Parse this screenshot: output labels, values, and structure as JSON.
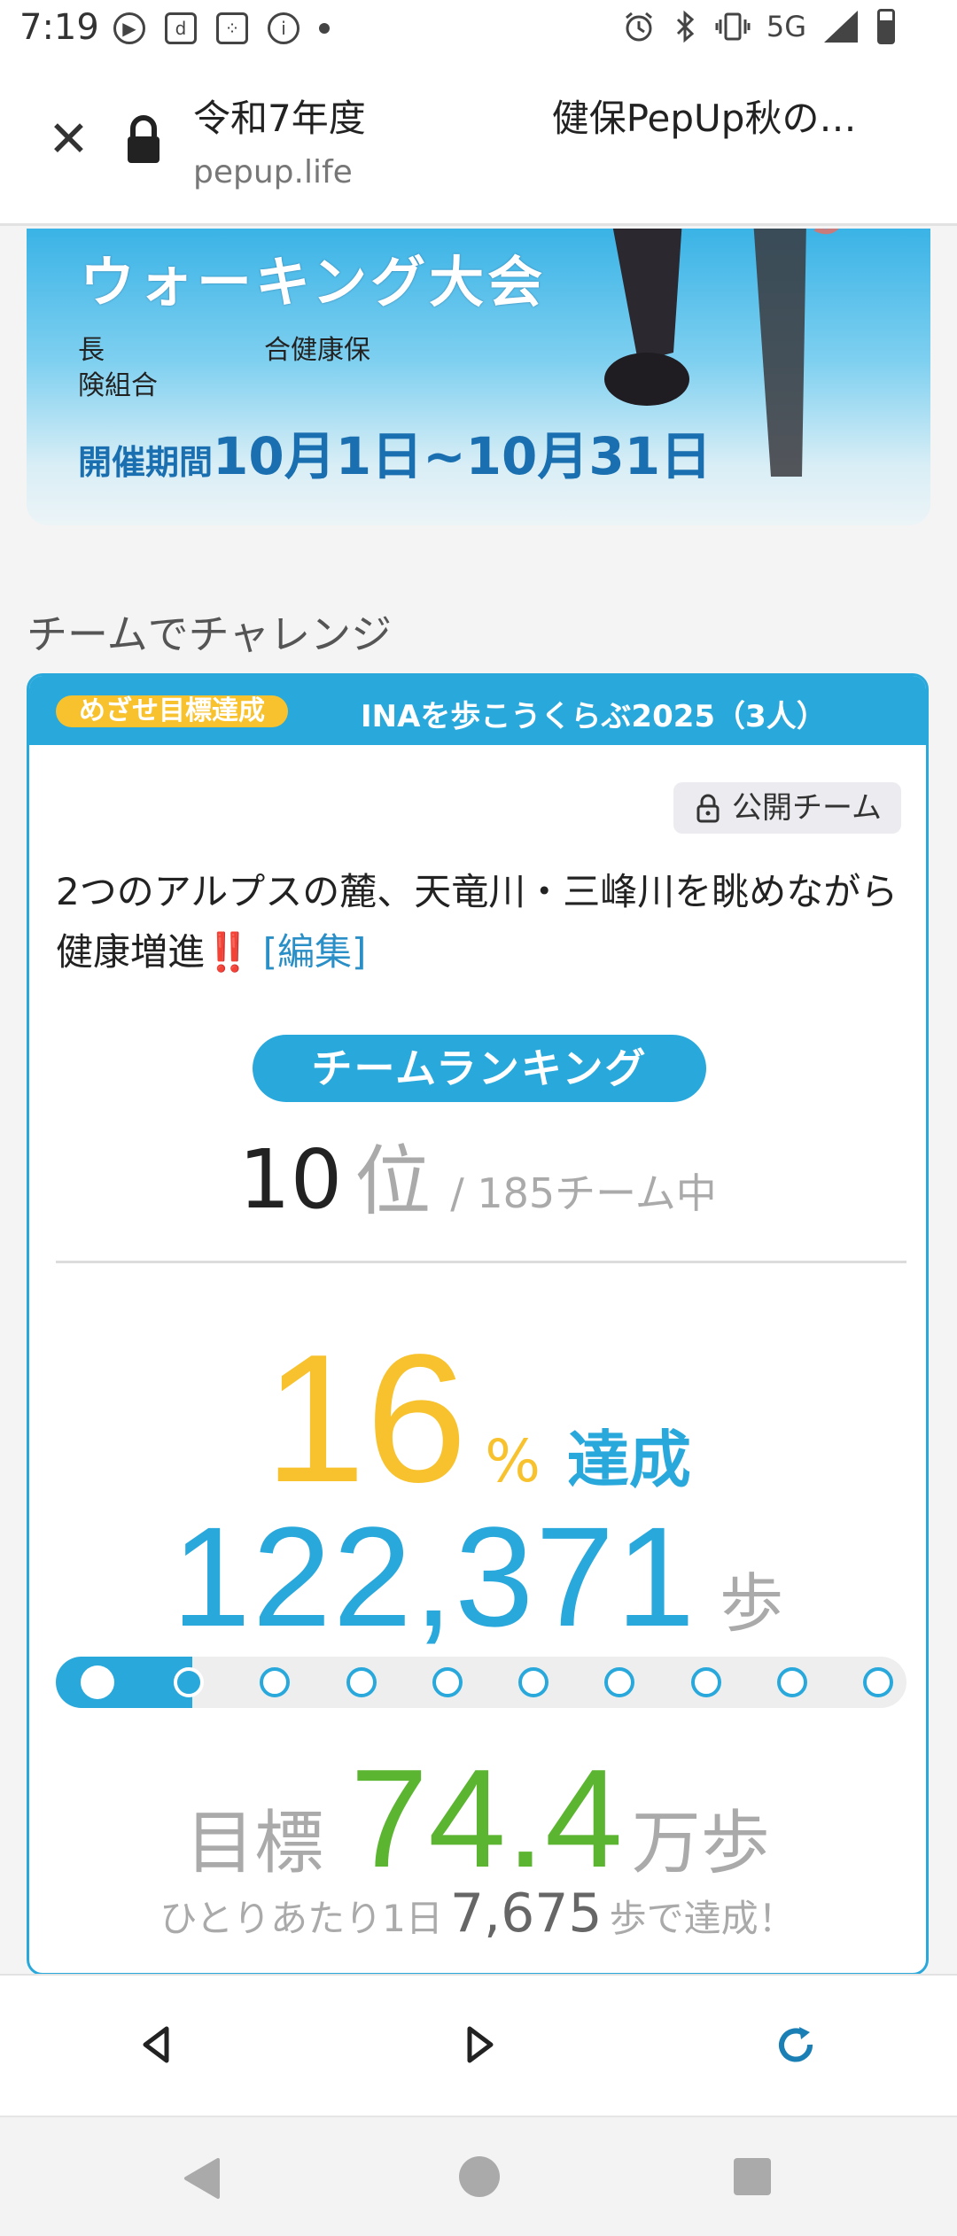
{
  "status_bar": {
    "time": "7:19",
    "network": "5G",
    "left_icons": [
      "play-icon",
      "d-icon",
      "dice-icon",
      "info-icon",
      "dot-icon"
    ],
    "right_icons": [
      "alarm-icon",
      "bluetooth-icon",
      "vibrate-icon",
      "signal-icon",
      "battery-icon"
    ]
  },
  "browser": {
    "page_title": "令和7年度　　　　　健保PepUp秋の…",
    "url": "pepup.life",
    "close_icon": "close-icon",
    "lock_icon": "lock-icon"
  },
  "banner": {
    "title": "ウォーキング大会",
    "org_line1": "長　　　　　　合健康保",
    "org_line2": "険組合",
    "period_label": "開催期間",
    "period_value": "10月1日~10月31日"
  },
  "section": {
    "heading": "チームでチャレンジ"
  },
  "team": {
    "goal_badge": "めざせ目標達成",
    "name": "INAを歩こうくらぶ2025（3人）",
    "public_badge": "公開チーム",
    "description": "2つのアルプスの麓、天竜川・三峰川を眺めながら健康増進",
    "exclamation": "‼️",
    "edit_link": "[編集]",
    "ranking_label": "チームランキング",
    "rank_value": "10",
    "rank_unit": "位",
    "rank_total": "/ 185チーム中",
    "achievement_percent": "16",
    "percent_symbol": "%",
    "achievement_word": "達成",
    "steps_value": "122,371",
    "steps_unit": "歩",
    "progress_fraction": 0.16,
    "milestone_count": 9,
    "target_label": "目標",
    "target_value": "74.4",
    "target_unit": "万歩",
    "daily_prefix": "ひとりあたり1日",
    "daily_value": "7,675",
    "daily_suffix": "歩で達成！"
  },
  "toolbar": {
    "back_icon": "back-triangle-icon",
    "forward_icon": "forward-triangle-icon",
    "reload_icon": "reload-icon"
  },
  "navigation": {
    "back_icon": "nav-back-icon",
    "home_icon": "nav-home-icon",
    "recents_icon": "nav-recents-icon"
  },
  "colors": {
    "accent_blue": "#29a8dc",
    "accent_yellow": "#f7c22e",
    "accent_green": "#5cb531"
  }
}
